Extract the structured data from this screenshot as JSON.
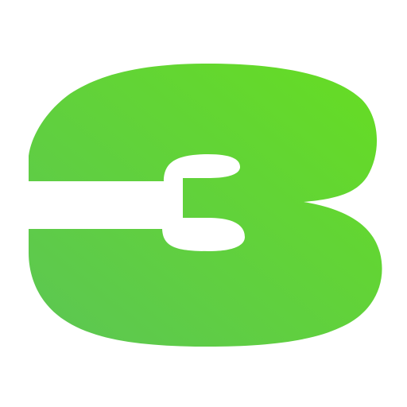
{
  "logo": {
    "icon": "stylized-number-three-logo-icon",
    "colors": {
      "gradient_start": "#5cc654",
      "gradient_end": "#66dd22",
      "background": "#ffffff"
    }
  }
}
